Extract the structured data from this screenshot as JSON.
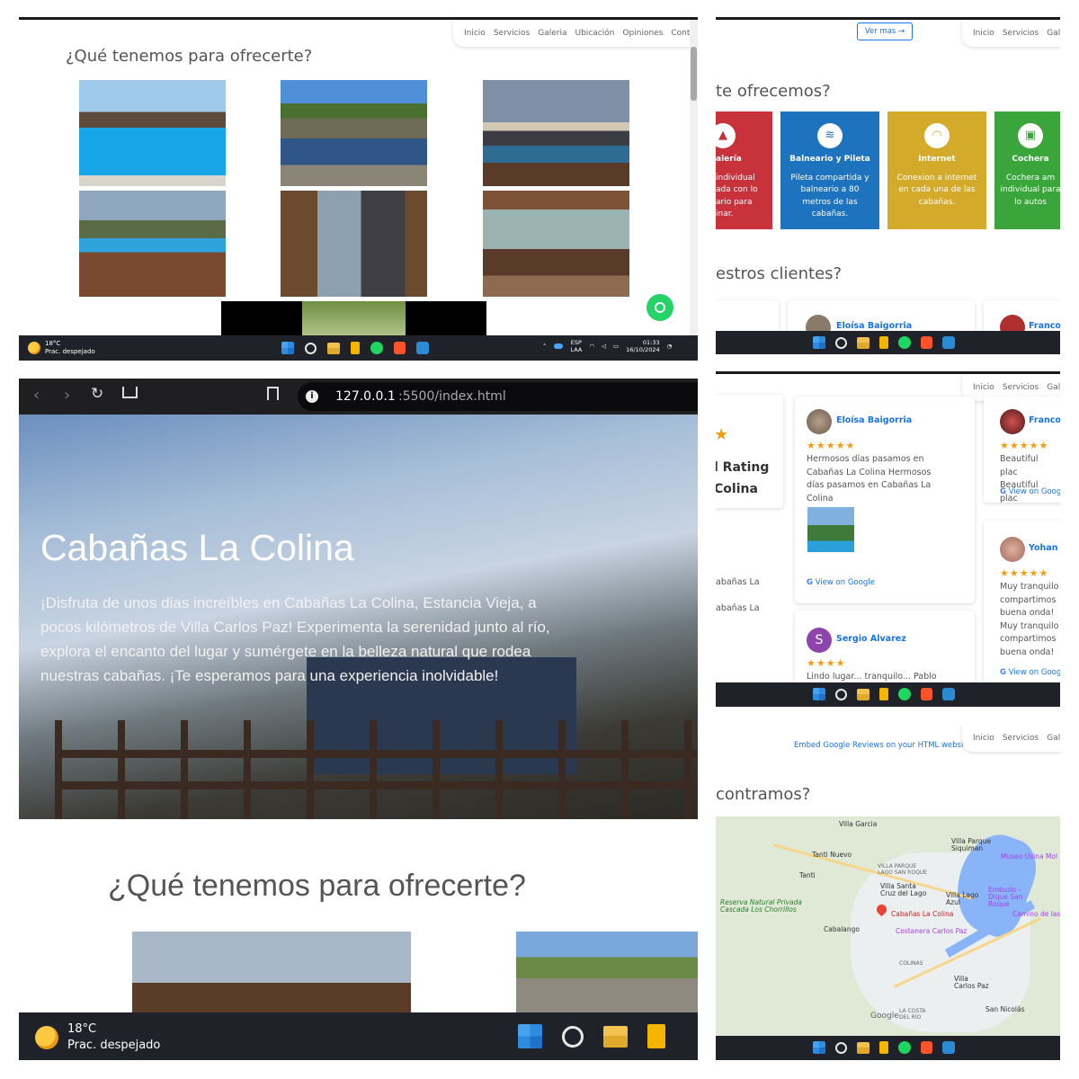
{
  "nav": [
    "Inicio",
    "Servicios",
    "Galeria",
    "Ubicación",
    "Opiniones",
    "Contacto"
  ],
  "nav_short": [
    "Inicio",
    "Servicios",
    "Galer"
  ],
  "gallery_title": "¿Qué tenemos para ofrecerte?",
  "taskbar": {
    "temp": "18°C",
    "weather": "Prac. despejado",
    "lang_1": "ESP",
    "lang_2": "LAA",
    "time": "01:33",
    "date": "16/10/2024"
  },
  "browser": {
    "url_host": "127.0.0.1",
    "url_rest": ":5500/index.html"
  },
  "hero": {
    "title": "Cabañas La Colina",
    "text": "¡Disfruta de unos dias increíbles en Cabañas La Colina, Estancia Vieja, a pocos kilómetros de Villa Carlos Paz! Experimenta la serenidad junto al río, explora el encanto del lugar y sumérgete en la belleza natural que rodea nuestras cabañas. ¡Te esperamos para una experiencia inolvidable!"
  },
  "services": {
    "ver_mas": "Ver mas →",
    "title_partial": "te ofrecemos?",
    "cards": [
      {
        "title": "alería",
        "text": "individual ada con lo ario para inar.",
        "color": "#c8323a",
        "icon": "fire-icon"
      },
      {
        "title": "Balneario y Pileta",
        "text": "Pileta compartida y balneario a 80 metros de las cabañas.",
        "color": "#1e73be",
        "icon": "waves-icon"
      },
      {
        "title": "Internet",
        "text": "Conexion a internet en cada una de las cabañas.",
        "color": "#d4aa2a",
        "icon": "wifi-icon"
      },
      {
        "title": "Cochera",
        "text": "Cochera am individual para lo autos",
        "color": "#3aa53a",
        "icon": "car-icon"
      }
    ],
    "clients_partial": "estros clientes?",
    "peek_names": [
      "Eloísa Baigorria",
      "Franco"
    ]
  },
  "reviews": {
    "rating_partial_1": "l Rating",
    "rating_partial_2": "Colina",
    "left_snips": [
      "abañas La",
      "abañas La"
    ],
    "items": [
      {
        "name": "Eloísa Baigorria",
        "stars": "★★★★★",
        "text": "Hermosos días pasamos en Cabañas La Colina Hermosos días pasamos en Cabañas La Colina",
        "view": "View on Google"
      },
      {
        "name": "Franco",
        "stars": "★★★★★",
        "text": "Beautiful plac Beautiful plac",
        "view": "View on Goog"
      },
      {
        "name": "Yohan",
        "stars": "★★★★★",
        "text": "Muy tranquilo compartimos buena onda! Muy tranquilo compartimos buena onda!",
        "view": "View on Goog"
      },
      {
        "name": "Sergio Alvarez",
        "initial": "S",
        "stars": "★★★★",
        "text": "Lindo lugar... tranquilo... Pablo",
        "view": ""
      }
    ]
  },
  "location": {
    "embed_text": "Embed Google Reviews on your HTML website",
    "title_partial": "contramos?",
    "map_labels": [
      "Villa Garcia",
      "Villa Parque Siquiman",
      "Museo Usina Mol",
      "Tanti Nuevo",
      "Tanti",
      "Villa Santa Cruz del Lago",
      "Villa Lago Azul",
      "Embudo - Dique San Roque",
      "Camino de las",
      "Reserva Natural Privada Cascada Los Chorrillos",
      "Cabalango",
      "Cabañas La Colina",
      "Costanera Carlos Paz",
      "Villa Carlos Paz",
      "San Nicolás",
      "Google",
      "COLINAS",
      "LA COSTA DEL RÍO",
      "VILLA PARQUE LAGO SAN ROQUE"
    ]
  }
}
